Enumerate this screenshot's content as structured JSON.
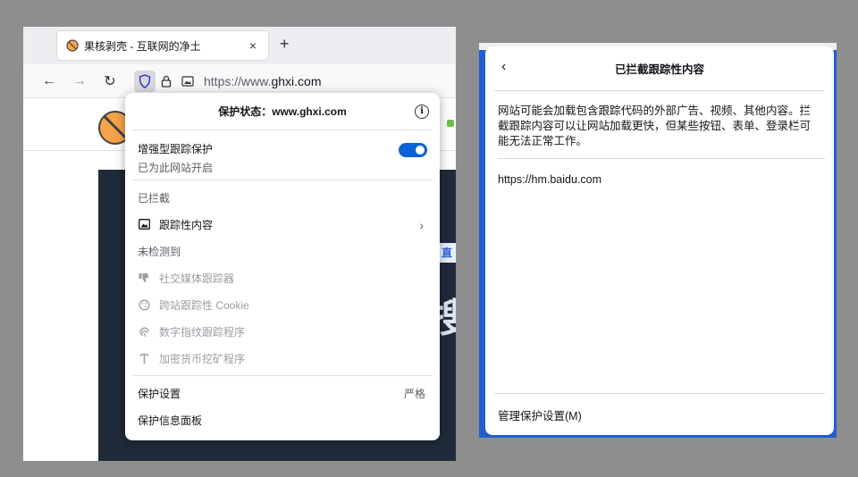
{
  "browser": {
    "tab": {
      "title": "果核剥壳 - 互联网的净土",
      "close": "×"
    },
    "new_tab": "+",
    "nav": {
      "back": "←",
      "forward": "→",
      "reload": "↻"
    },
    "url_prefix": "https://www.",
    "url_domain": "ghxi.com"
  },
  "popup": {
    "title": "保护状态：www.ghxi.com",
    "info_icon": "i",
    "etp_title": "增强型跟踪保护",
    "etp_status": "已为此网站开启",
    "etp_enabled": true,
    "blocked_label": "已拦截",
    "blocked_items": [
      {
        "label": "跟踪性内容",
        "icon": "image-icon"
      }
    ],
    "not_detected_label": "未检测到",
    "not_detected_items": [
      {
        "label": "社交媒体跟踪器",
        "icon": "thumbs-down-icon"
      },
      {
        "label": "跨站跟踪性 Cookie",
        "icon": "cookie-icon"
      },
      {
        "label": "数字指纹跟踪程序",
        "icon": "fingerprint-icon"
      },
      {
        "label": "加密货币挖矿程序",
        "icon": "pickaxe-icon"
      }
    ],
    "settings_label": "保护设置",
    "settings_value": "严格",
    "dashboard_label": "保护信息面板"
  },
  "panel": {
    "back": "‹",
    "title": "已拦截跟踪性内容",
    "description": "网站可能会加载包含跟踪代码的外部广告、视频、其他内容。拦截跟踪内容可以让网站加载更快，但某些按钮、表单、登录栏可能无法正常工作。",
    "tracker": "https://hm.baidu.com",
    "footer": "管理保护设置(M)"
  },
  "page": {
    "badge": "直",
    "big_glyph": "搜"
  },
  "colors": {
    "toggle_on": "#0a62d8",
    "page_dark": "#1f2b3a",
    "right_bg": "#1f5fcf"
  }
}
